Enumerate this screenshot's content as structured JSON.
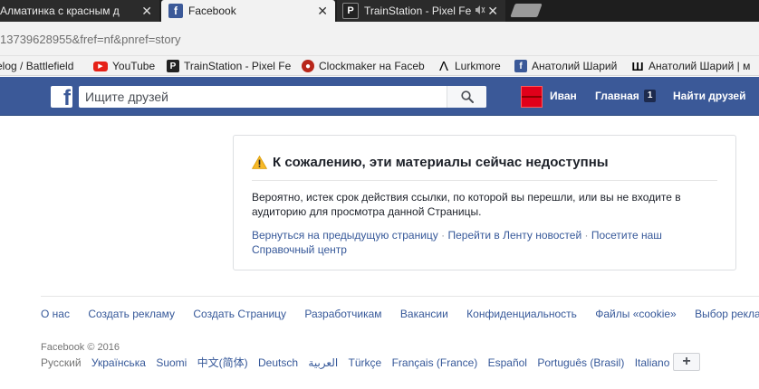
{
  "browser": {
    "tabs": [
      {
        "label": "Алматинка с красным д",
        "active": false
      },
      {
        "label": "Facebook",
        "active": true
      },
      {
        "label": "TrainStation - Pixel Fe",
        "active": false
      }
    ],
    "close_glyph": "✕",
    "url": "13739628955&fref=nf&pnref=story",
    "bookmarks": [
      {
        "label": "elog / Battlefield",
        "icon": "none"
      },
      {
        "label": "YouTube",
        "icon": "youtube-icon"
      },
      {
        "label": "TrainStation - Pixel Fe",
        "icon": "pixel-federation-icon"
      },
      {
        "label": "Clockmaker на Faceb",
        "icon": "clockmaker-icon"
      },
      {
        "label": "Lurkmore",
        "icon": "lambda-icon"
      },
      {
        "label": "Анатолий Шарий",
        "icon": "facebook-icon"
      },
      {
        "label": "Анатолий Шарий | м",
        "icon": "sharij-icon"
      }
    ]
  },
  "header": {
    "search_placeholder": "Ищите друзей",
    "user_name": "Иван",
    "home_label": "Главная",
    "home_badge": "1",
    "find_friends_label": "Найти друзей"
  },
  "content": {
    "title": "К сожалению, эти материалы сейчас недоступны",
    "body": "Вероятно, истек срок действия ссылки, по которой вы перешли, или вы не входите в аудиторию для просмотра данной Страницы.",
    "links": [
      "Вернуться на предыдущую страницу",
      "Перейти в Ленту новостей",
      "Посетите наш Справочный центр"
    ],
    "separator": "·"
  },
  "footer": {
    "links": [
      "О нас",
      "Создать рекламу",
      "Создать Страницу",
      "Разработчикам",
      "Вакансии",
      "Конфиденциальность",
      "Файлы «cookie»",
      "Выбор рекламы"
    ],
    "copyright": "Facebook © 2016",
    "languages": [
      "Русский",
      "Українська",
      "Suomi",
      "中文(简体)",
      "Deutsch",
      "العربية",
      "Türkçe",
      "Français (France)",
      "Español",
      "Português (Brasil)",
      "Italiano"
    ],
    "more_languages": "+"
  },
  "colors": {
    "facebook_blue": "#3b5998",
    "link_blue": "#365899",
    "warning_yellow": "#f7b928"
  }
}
